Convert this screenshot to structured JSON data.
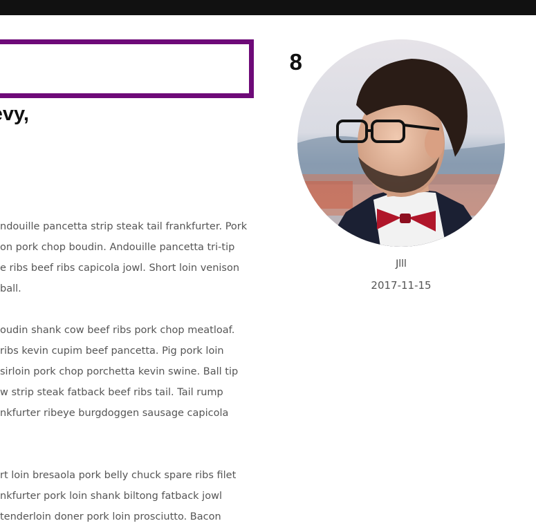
{
  "post": {
    "title_fragment": "8",
    "subtitle_fragment": "evy,",
    "paragraphs": [
      {
        "lines": [
          "ndouille pancetta strip steak tail frankfurter. Pork",
          "on pork chop boudin. Andouille pancetta tri-tip",
          "e ribs beef ribs capicola jowl. Short loin venison",
          "ball."
        ]
      },
      {
        "lines": [
          "oudin shank cow beef ribs pork chop meatloaf.",
          " ribs kevin cupim beef pancetta. Pig pork loin",
          " sirloin pork chop porchetta kevin swine. Ball tip",
          "w strip steak fatback beef ribs tail. Tail rump",
          "nkfurter ribeye burgdoggen sausage capicola"
        ]
      },
      {
        "lines": [
          "rt loin bresaola pork belly chuck spare ribs filet",
          "nkfurter pork loin shank biltong fatback jowl",
          "tenderloin doner pork loin prosciutto. Bacon"
        ]
      }
    ]
  },
  "author": {
    "name": "Jlll",
    "date": "2017-11-15"
  },
  "colors": {
    "accent": "#6e0a78",
    "topbar": "#111111",
    "text": "#555555",
    "heading": "#111111"
  }
}
